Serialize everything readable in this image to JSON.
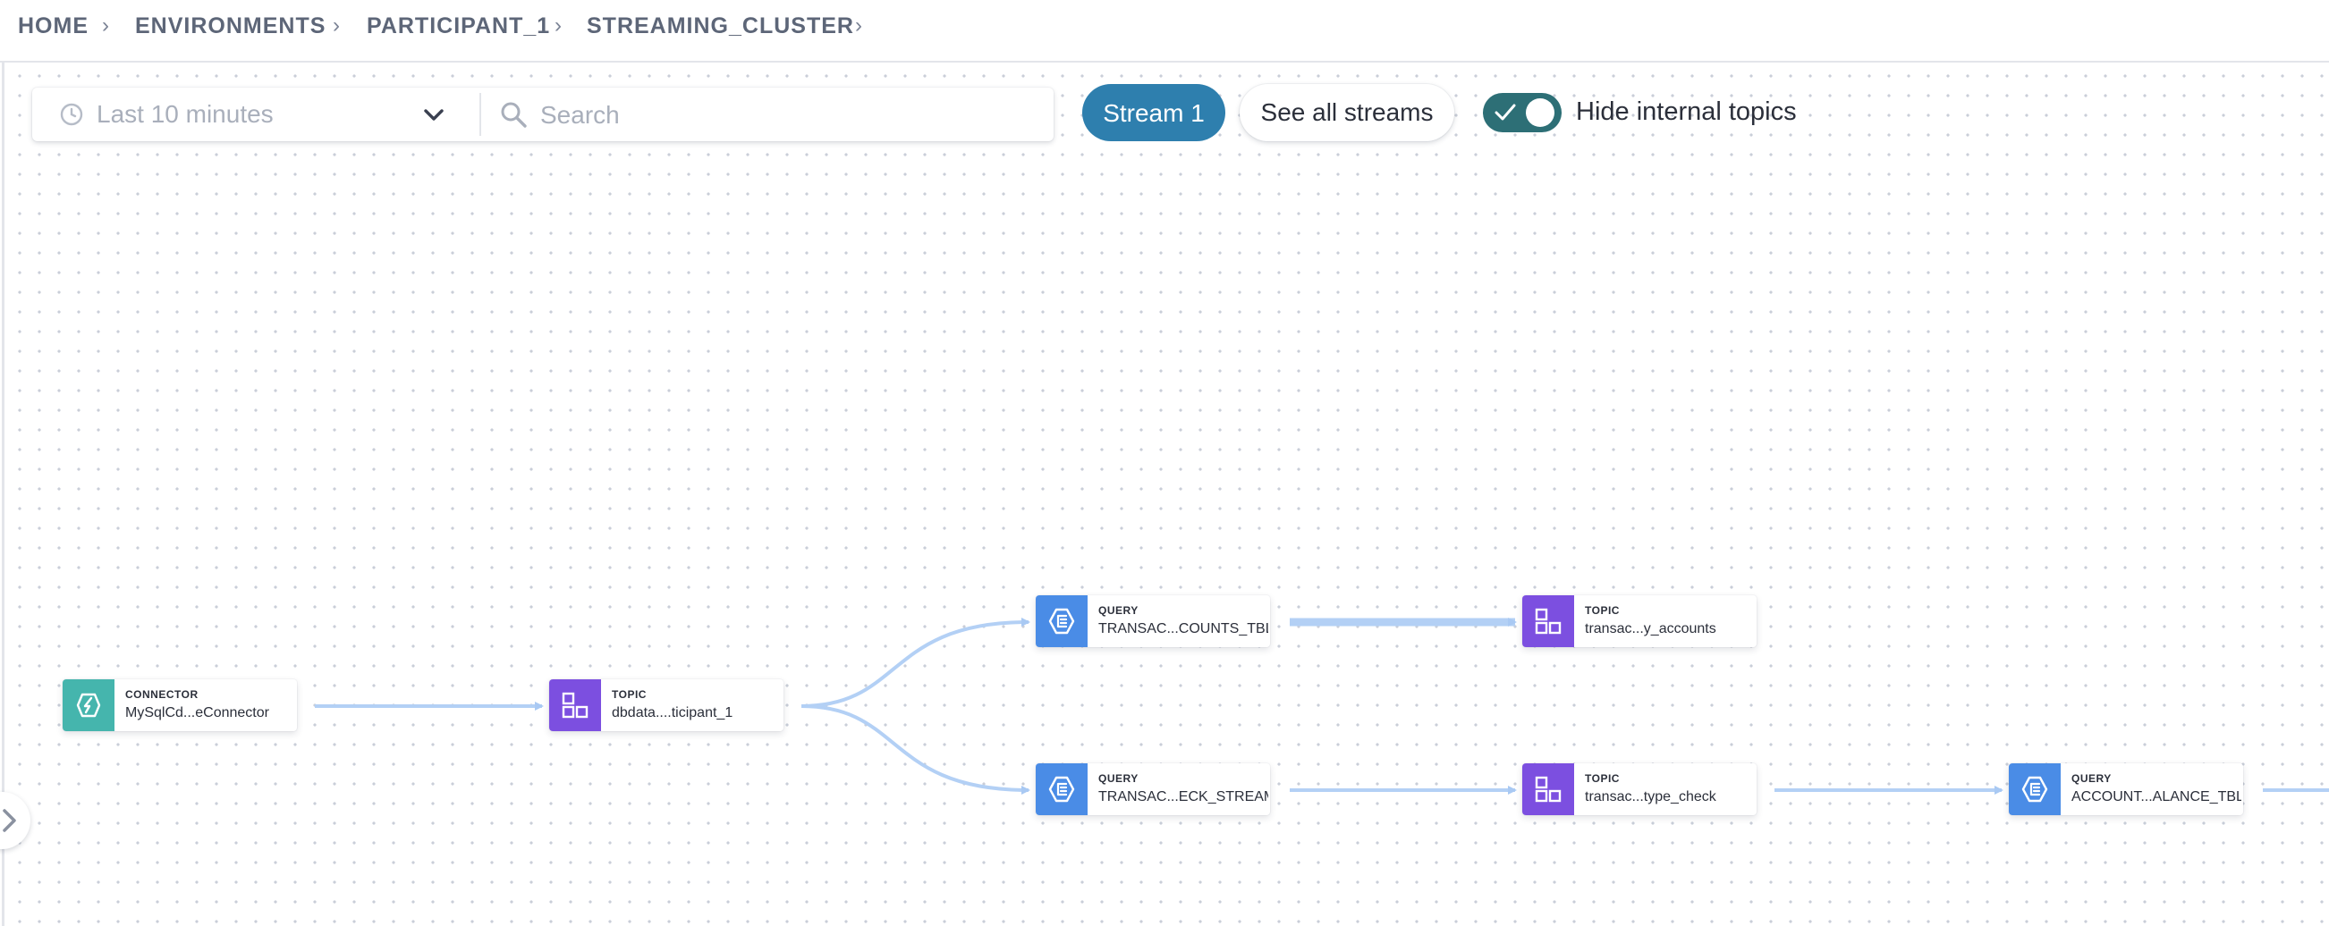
{
  "breadcrumb": {
    "items": [
      "HOME",
      "ENVIRONMENTS",
      "PARTICIPANT_1",
      "STREAMING_CLUSTER"
    ]
  },
  "toolbar": {
    "time_range": "Last 10 minutes",
    "search_placeholder": "Search",
    "stream_button": "Stream 1",
    "see_all_button": "See all streams",
    "hide_internal_label": "Hide internal topics",
    "hide_internal_checked": true
  },
  "colors": {
    "primary": "#2e7fae",
    "toggle": "#2d6f76",
    "connector": "#45b5ad",
    "topic": "#7c4fe0",
    "query": "#4a8ce6",
    "edge": "#b3d0f5"
  },
  "graph": {
    "nodes": [
      {
        "type": "CONNECTOR",
        "name": "MySqlCd...eConnector",
        "icon": "connector-icon"
      },
      {
        "type": "TOPIC",
        "name": "dbdata....ticipant_1",
        "icon": "topic-icon"
      },
      {
        "type": "QUERY",
        "name": "TRANSAC...COUNTS_TBL",
        "icon": "query-icon"
      },
      {
        "type": "TOPIC",
        "name": "transac...y_accounts",
        "icon": "topic-icon"
      },
      {
        "type": "QUERY",
        "name": "TRANSAC...ECK_STREAM",
        "icon": "query-icon"
      },
      {
        "type": "TOPIC",
        "name": "transac...type_check",
        "icon": "topic-icon"
      },
      {
        "type": "QUERY",
        "name": "ACCOUNT...ALANCE_TBL",
        "icon": "query-icon"
      }
    ]
  }
}
